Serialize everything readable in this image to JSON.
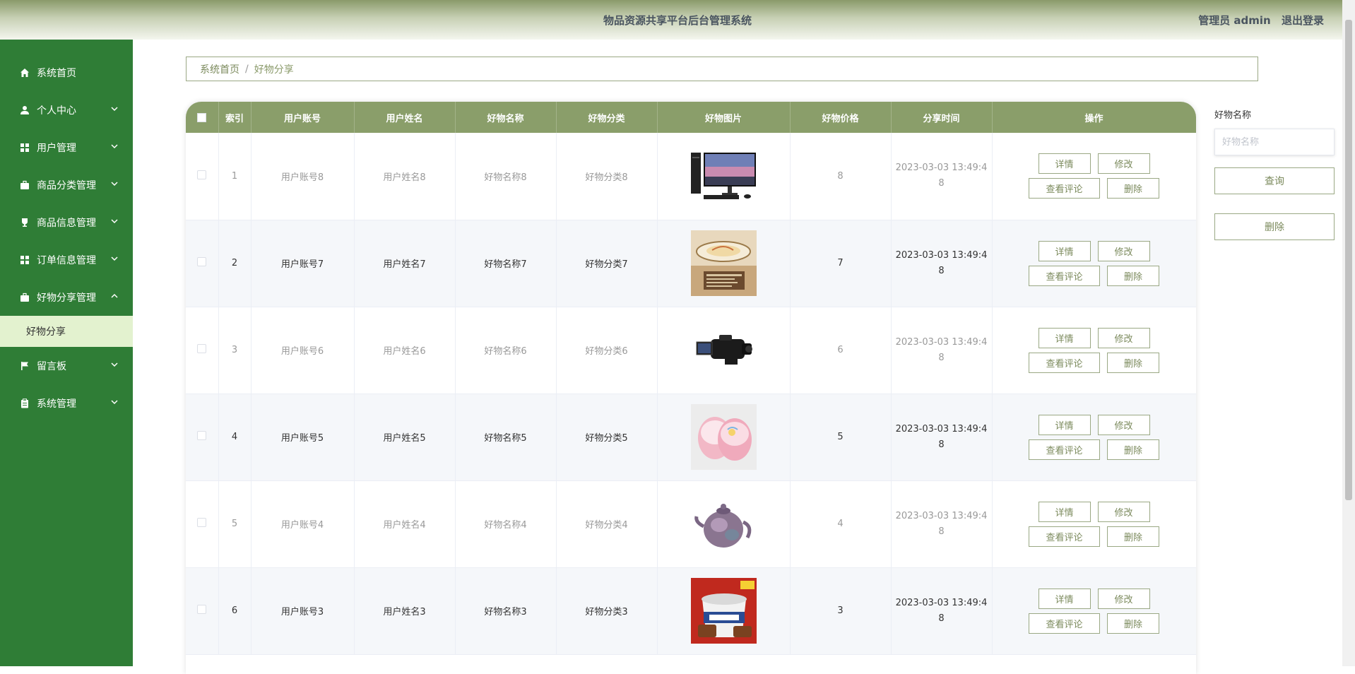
{
  "header": {
    "title": "物品资源共享平台后台管理系统",
    "user_label": "管理员 admin",
    "logout": "退出登录"
  },
  "sidebar": {
    "items": [
      {
        "label": "系统首页",
        "icon": "home-icon",
        "chevron": false
      },
      {
        "label": "个人中心",
        "icon": "person-icon",
        "chevron": "down"
      },
      {
        "label": "用户管理",
        "icon": "grid-icon",
        "chevron": "down"
      },
      {
        "label": "商品分类管理",
        "icon": "briefcase-icon",
        "chevron": "down"
      },
      {
        "label": "商品信息管理",
        "icon": "trophy-icon",
        "chevron": "down"
      },
      {
        "label": "订单信息管理",
        "icon": "grid-icon",
        "chevron": "down"
      },
      {
        "label": "好物分享管理",
        "icon": "briefcase-icon",
        "chevron": "up"
      },
      {
        "label": "好物分享",
        "sub": true
      },
      {
        "label": "留言板",
        "icon": "flag-icon",
        "chevron": "down"
      },
      {
        "label": "系统管理",
        "icon": "clipboard-icon",
        "chevron": "down"
      }
    ]
  },
  "breadcrumb": {
    "home": "系统首页",
    "separator": "/",
    "current": "好物分享"
  },
  "table": {
    "headers": [
      "索引",
      "用户账号",
      "用户姓名",
      "好物名称",
      "好物分类",
      "好物图片",
      "好物价格",
      "分享时间",
      "操作"
    ],
    "actions": {
      "detail": "详情",
      "edit": "修改",
      "comments": "查看评论",
      "delete": "删除"
    },
    "rows": [
      {
        "index": "1",
        "account": "用户账号8",
        "name": "用户姓名8",
        "item": "好物名称8",
        "category": "好物分类8",
        "image": "computer",
        "price": "8",
        "time_line1": "2023-03-03 13:49:4",
        "time_line2": "8"
      },
      {
        "index": "2",
        "account": "用户账号7",
        "name": "用户姓名7",
        "item": "好物名称7",
        "category": "好物分类7",
        "image": "ceiling-lamp",
        "price": "7",
        "time_line1": "2023-03-03 13:49:4",
        "time_line2": "8"
      },
      {
        "index": "3",
        "account": "用户账号6",
        "name": "用户姓名6",
        "item": "好物名称6",
        "category": "好物分类6",
        "image": "camcorder",
        "price": "6",
        "time_line1": "2023-03-03 13:49:4",
        "time_line2": "8"
      },
      {
        "index": "4",
        "account": "用户账号5",
        "name": "用户姓名5",
        "item": "好物名称5",
        "category": "好物分类5",
        "image": "slippers",
        "price": "5",
        "time_line1": "2023-03-03 13:49:4",
        "time_line2": "8"
      },
      {
        "index": "5",
        "account": "用户账号4",
        "name": "用户姓名4",
        "item": "好物名称4",
        "category": "好物分类4",
        "image": "teapot",
        "price": "4",
        "time_line1": "2023-03-03 13:49:4",
        "time_line2": "8"
      },
      {
        "index": "6",
        "account": "用户账号3",
        "name": "用户姓名3",
        "item": "好物名称3",
        "category": "好物分类3",
        "image": "ice-cream",
        "price": "3",
        "time_line1": "2023-03-03 13:49:4",
        "time_line2": "8"
      }
    ]
  },
  "search": {
    "label": "好物名称",
    "placeholder": "好物名称",
    "query_button": "查询",
    "delete_button": "删除"
  }
}
